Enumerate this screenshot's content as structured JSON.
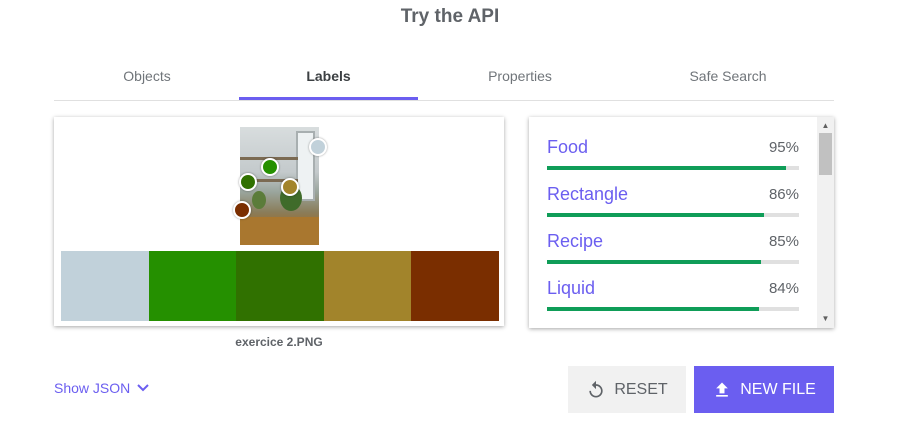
{
  "page": {
    "title": "Try the API"
  },
  "tabs": [
    {
      "label": "Objects",
      "active": false
    },
    {
      "label": "Labels",
      "active": true
    },
    {
      "label": "Properties",
      "active": false
    },
    {
      "label": "Safe Search",
      "active": false
    }
  ],
  "image_panel": {
    "filename": "exercice 2.PNG",
    "dominant_colors": [
      "#c1d1da",
      "#259000",
      "#307100",
      "#a2842b",
      "#7a2e00"
    ]
  },
  "labels": [
    {
      "name": "Food",
      "score_text": "95%",
      "score": 0.95
    },
    {
      "name": "Rectangle",
      "score_text": "86%",
      "score": 0.86
    },
    {
      "name": "Recipe",
      "score_text": "85%",
      "score": 0.85
    },
    {
      "name": "Liquid",
      "score_text": "84%",
      "score": 0.84
    }
  ],
  "footer": {
    "show_json_label": "Show JSON",
    "reset_label": "RESET",
    "new_file_label": "NEW FILE"
  },
  "colors": {
    "accent": "#6b5ef0",
    "score_bar": "#0f9d58"
  }
}
